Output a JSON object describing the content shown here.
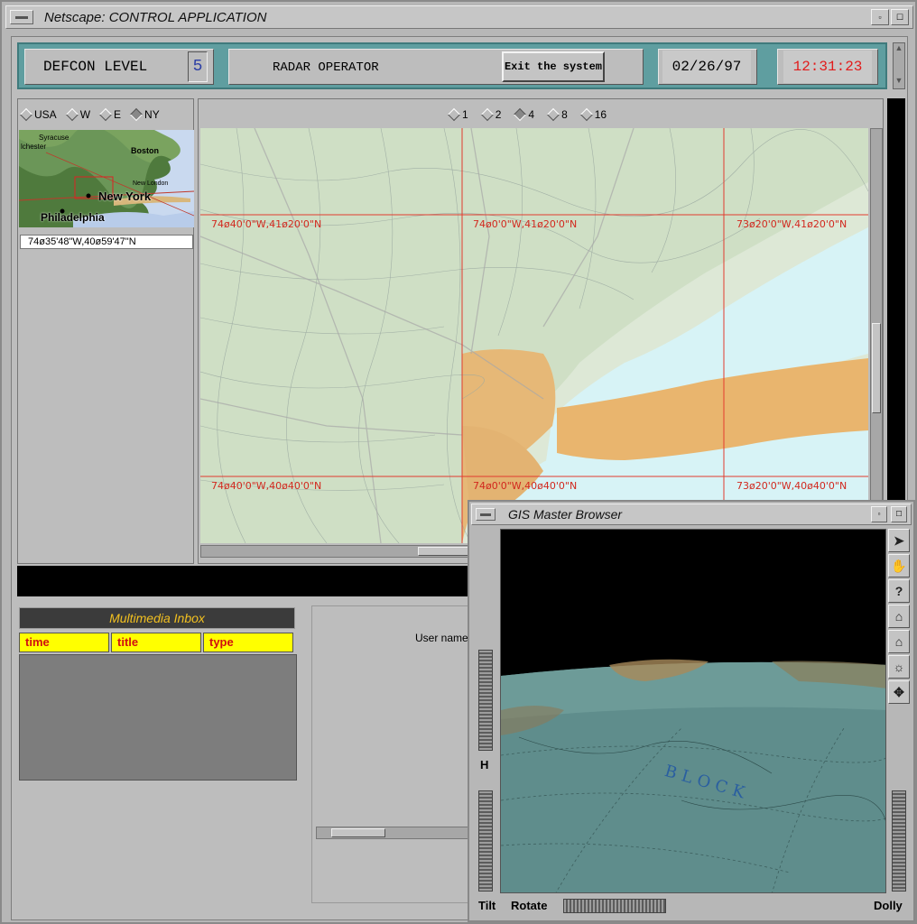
{
  "window": {
    "title": "Netscape: CONTROL APPLICATION",
    "iconify": "▫",
    "maximize": "☐"
  },
  "header": {
    "defcon_label": "DEFCON LEVEL",
    "defcon_value": "5",
    "role": "RADAR OPERATOR",
    "exit_label": "Exit the system",
    "date": "02/26/97",
    "time": "12:31:23",
    "colors": {
      "bar": "#5f9ea0",
      "time": "#e21b1b"
    }
  },
  "region": {
    "options": [
      "USA",
      "W",
      "E",
      "NY"
    ],
    "selected": "NY",
    "coordinate": "74ø35'48\"W,40ø59'47\"N",
    "minimap_labels": [
      "New York",
      "Philadelphia",
      "Boston",
      "Syracuse",
      "New London",
      "lchester"
    ]
  },
  "map": {
    "zoom_options": [
      "1",
      "2",
      "4",
      "8",
      "16"
    ],
    "zoom_selected": "4",
    "grid_labels": {
      "r1c1": "74ø40'0\"W,41ø20'0\"N",
      "r1c2": "74ø0'0\"W,41ø20'0\"N",
      "r1c3": "73ø20'0\"W,41ø20'0\"N",
      "r2c1": "74ø40'0\"W,40ø40'0\"N",
      "r2c2": "74ø0'0\"W,40ø40'0\"N",
      "r2c3": "73ø20'0\"W,40ø40'0\"N"
    }
  },
  "inbox": {
    "title": "Multimedia Inbox",
    "columns": [
      "time",
      "title",
      "type"
    ],
    "rows": []
  },
  "login": {
    "username_label": "User name"
  },
  "gis": {
    "title": "GIS Master Browser",
    "tools": [
      "arrow-icon",
      "hand-icon",
      "help-icon",
      "home-icon",
      "set-home-icon",
      "view-all-icon",
      "seek-icon"
    ],
    "tool_glyphs": [
      "➤",
      "✋",
      "?",
      "⌂",
      "⌂",
      "☼",
      "✥"
    ],
    "wheel_h_label": "H",
    "tilt_label": "Tilt",
    "rotate_label": "Rotate",
    "dolly_label": "Dolly",
    "globe_text": "BLOCK"
  }
}
